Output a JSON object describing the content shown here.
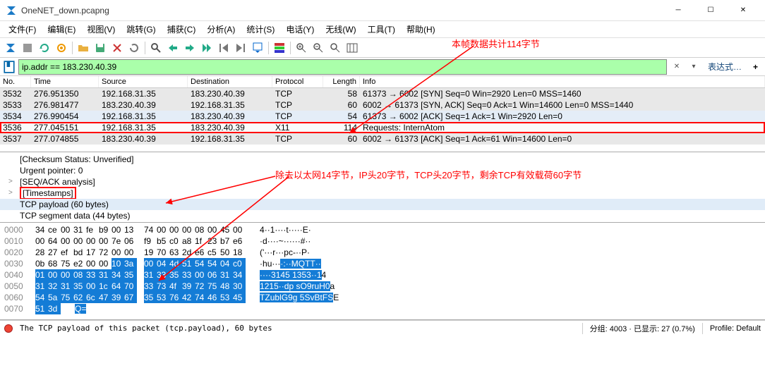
{
  "window": {
    "title": "OneNET_down.pcapng"
  },
  "menu": {
    "file": "文件(F)",
    "edit": "编辑(E)",
    "view": "视图(V)",
    "jump": "跳转(G)",
    "capture": "捕获(C)",
    "analyze": "分析(A)",
    "stats": "统计(S)",
    "tele": "电话(Y)",
    "wireless": "无线(W)",
    "tools": "工具(T)",
    "help": "帮助(H)"
  },
  "filter": {
    "value": "ip.addr == 183.230.40.39",
    "expr_label": "表达式…"
  },
  "packet_headers": {
    "no": "No.",
    "time": "Time",
    "src": "Source",
    "dst": "Destination",
    "proto": "Protocol",
    "len": "Length",
    "info": "Info"
  },
  "packets": [
    {
      "no": "3532",
      "time": "276.951350",
      "src": "192.168.31.35",
      "dst": "183.230.40.39",
      "proto": "TCP",
      "len": "58",
      "info": "61373 → 6002 [SYN] Seq=0 Win=2920 Len=0 MSS=1460",
      "cls": "normal"
    },
    {
      "no": "3533",
      "time": "276.981477",
      "src": "183.230.40.39",
      "dst": "192.168.31.35",
      "proto": "TCP",
      "len": "60",
      "info": "6002 → 61373 [SYN, ACK] Seq=0 Ack=1 Win=14600 Len=0 MSS=1440",
      "cls": "normal"
    },
    {
      "no": "3534",
      "time": "276.990454",
      "src": "192.168.31.35",
      "dst": "183.230.40.39",
      "proto": "TCP",
      "len": "54",
      "info": "61373 → 6002 [ACK] Seq=1 Ack=1 Win=2920 Len=0",
      "cls": "sel"
    },
    {
      "no": "3536",
      "time": "277.045151",
      "src": "192.168.31.35",
      "dst": "183.230.40.39",
      "proto": "X11",
      "len": "114",
      "info": "Requests: InternAtom",
      "cls": "highlight"
    },
    {
      "no": "3537",
      "time": "277.074855",
      "src": "183.230.40.39",
      "dst": "192.168.31.35",
      "proto": "TCP",
      "len": "60",
      "info": "6002 → 61373 [ACK] Seq=1 Ack=61 Win=14600 Len=0",
      "cls": "normal"
    }
  ],
  "details": [
    {
      "text": "[Checksum Status: Unverified]",
      "indent": 1
    },
    {
      "text": "Urgent pointer: 0",
      "indent": 1
    },
    {
      "text": "[SEQ/ACK analysis]",
      "indent": 1,
      "toggle": ">"
    },
    {
      "text": "[Timestamps]",
      "indent": 1,
      "toggle": ">",
      "red": true
    },
    {
      "text": "TCP payload (60 bytes)",
      "indent": 1,
      "sel": true
    },
    {
      "text": "TCP segment data (44 bytes)",
      "indent": 1
    }
  ],
  "hex": {
    "rows": [
      {
        "off": "0000",
        "bytes": [
          "34",
          "ce",
          "00",
          "31",
          "fe",
          "b9",
          "00",
          "13",
          "74",
          "00",
          "00",
          "00",
          "08",
          "00",
          "45",
          "00"
        ],
        "ascii": "4··1····t·····E·",
        "sel": []
      },
      {
        "off": "0010",
        "bytes": [
          "00",
          "64",
          "00",
          "00",
          "00",
          "00",
          "7e",
          "06",
          "f9",
          "b5",
          "c0",
          "a8",
          "1f",
          "23",
          "b7",
          "e6"
        ],
        "ascii": "·d····~······#··",
        "sel": []
      },
      {
        "off": "0020",
        "bytes": [
          "28",
          "27",
          "ef",
          "bd",
          "17",
          "72",
          "00",
          "00",
          "19",
          "70",
          "63",
          "2d",
          "e6",
          "c5",
          "50",
          "18"
        ],
        "ascii": "('···r···pc-··P·",
        "sel": []
      },
      {
        "off": "0030",
        "bytes": [
          "0b",
          "68",
          "75",
          "e2",
          "00",
          "00",
          "10",
          "3a",
          "00",
          "04",
          "4d",
          "51",
          "54",
          "54",
          "04",
          "c0"
        ],
        "ascii": "·hu····:··MQTT··",
        "sel": [
          0,
          0,
          0,
          0,
          0,
          0,
          1,
          1,
          1,
          1,
          1,
          1,
          1,
          1,
          1,
          1
        ]
      },
      {
        "off": "0040",
        "bytes": [
          "01",
          "00",
          "00",
          "08",
          "33",
          "31",
          "34",
          "35",
          "31",
          "33",
          "35",
          "33",
          "00",
          "06",
          "31",
          "34"
        ],
        "ascii": "····3145 1353··14",
        "sel": [
          1,
          1,
          1,
          1,
          1,
          1,
          1,
          1,
          1,
          1,
          1,
          1,
          1,
          1,
          1,
          1
        ]
      },
      {
        "off": "0050",
        "bytes": [
          "31",
          "32",
          "31",
          "35",
          "00",
          "1c",
          "64",
          "70",
          "33",
          "73",
          "4f",
          "39",
          "72",
          "75",
          "48",
          "30"
        ],
        "ascii": "1215··dp sO9ruH0a",
        "sel": [
          1,
          1,
          1,
          1,
          1,
          1,
          1,
          1,
          1,
          1,
          1,
          1,
          1,
          1,
          1,
          1
        ]
      },
      {
        "off": "0060",
        "bytes": [
          "54",
          "5a",
          "75",
          "62",
          "6c",
          "47",
          "39",
          "67",
          "35",
          "53",
          "76",
          "42",
          "74",
          "46",
          "53",
          "45"
        ],
        "ascii": "TZublG9g 5SvBtFSE",
        "sel": [
          1,
          1,
          1,
          1,
          1,
          1,
          1,
          1,
          1,
          1,
          1,
          1,
          1,
          1,
          1,
          1
        ]
      },
      {
        "off": "0070",
        "bytes": [
          "51",
          "3d"
        ],
        "ascii": "Q=",
        "sel": [
          1,
          1
        ]
      }
    ]
  },
  "annotations": {
    "top": "本帧数据共计114字节",
    "mid": "除去以太网14字节，IP头20字节，TCP头20字节，剩余TCP有效载荷60字节"
  },
  "status": {
    "left": "The TCP payload of this packet (tcp.payload), 60 bytes",
    "mid": "分组: 4003 · 已显示: 27 (0.7%)",
    "right": "Profile: Default"
  }
}
